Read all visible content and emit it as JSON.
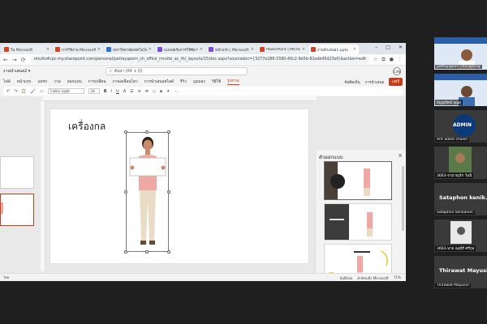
{
  "browser": {
    "tabs": [
      {
        "label": "ใน Microsoft",
        "color": "#d04423",
        "active": false
      },
      {
        "label": "การใช้งาน Microsoft",
        "color": "#d04423",
        "active": false
      },
      {
        "label": "มหาวิทยาลัยเทคโนโลยีราช",
        "color": "#2f6fd3",
        "active": false
      },
      {
        "label": "แบบฟอร์มการใช้ซีอาร์",
        "color": "#7b4fd3",
        "active": false
      },
      {
        "label": "หน้าแรก | Microsoft",
        "color": "#7b4fd3",
        "active": false
      },
      {
        "label": "PowerPoint | Microso",
        "color": "#d04423",
        "active": false
      },
      {
        "label": "งานนำเสนอ1.pptx",
        "color": "#d04423",
        "active": true
      }
    ],
    "url": "rmutto4cpc-my.sharepoint.com/personal/pattayaporn_ch_office_rmutto_ac_th/_layouts/15/doc.aspx?sourcedoc={3277e286-1580-40c2-9e5b-82ede45d23ef}&action=edit"
  },
  "office": {
    "doc_name": "งานนำเสนอ2 ▾",
    "search_placeholder": "ค้นหา (Alt + Q)",
    "avatar_initials": "ChN",
    "ribbon_tabs": [
      "ไฟล์",
      "หน้าแรก",
      "แทรก",
      "วาด",
      "ออกแบบ",
      "การเปลี่ยน",
      "ภาพเคลื่อนไหว",
      "การนำเสนอสไลด์",
      "รีวิว",
      "มุมมอง",
      "วิธีใช้",
      "รูปภาพ"
    ],
    "active_tab": "รูปภาพ",
    "ribbon_right": [
      "มีเพิ่มเติม",
      "ข้อคิดเห็น",
      "พิมพ์",
      "ขนาดผู้ดู"
    ],
    "present_label": "การนำเสนอ",
    "share_label": "แชร์",
    "toolbar": {
      "undo": "↶",
      "redo": "↷",
      "font": "Calibri Light",
      "size": "24",
      "bold": "B",
      "italic": "I",
      "underline": "U"
    },
    "slide_title": "เครื่องกล",
    "designer_title": "ตัวออกแบบ",
    "designer_close": "×",
    "designs": [
      {
        "label": "เครื่องกล"
      },
      {
        "label": "เครื่องกล"
      },
      {
        "label": "เครื่องกล"
      },
      {
        "label": "เครื่องกล"
      }
    ],
    "status": {
      "left": "ไทย",
      "feedback": "คำติชมถึง Microsoft",
      "notes": "บันทึกย่อ",
      "zoom": "71%"
    }
  },
  "meeting": {
    "participants": [
      {
        "name": "pattayaporn changsong",
        "org": "RMUTTO Library",
        "kind": "video"
      },
      {
        "name": "ธัญญรัตน์ บุญสุ",
        "org": "RMUTTO Library",
        "kind": "video"
      },
      {
        "name": "Arit adom chaisri",
        "label": "ADMIN",
        "kind": "badge"
      },
      {
        "name": "3663-จามาณุรัก วันนิ",
        "kind": "video"
      },
      {
        "name": "Sataphon kenkanon",
        "display": "Sataphon kenik...",
        "kind": "name"
      },
      {
        "name": "3663-นาย ฉลุนีรี ศรีกุล",
        "kind": "video"
      },
      {
        "name": "Thirawat Mayusiri",
        "display": "Thirawat Mayusiri",
        "kind": "name"
      }
    ]
  },
  "colors": {
    "accent": "#c43e1c",
    "meeting_bg": "#1f1f1f"
  }
}
